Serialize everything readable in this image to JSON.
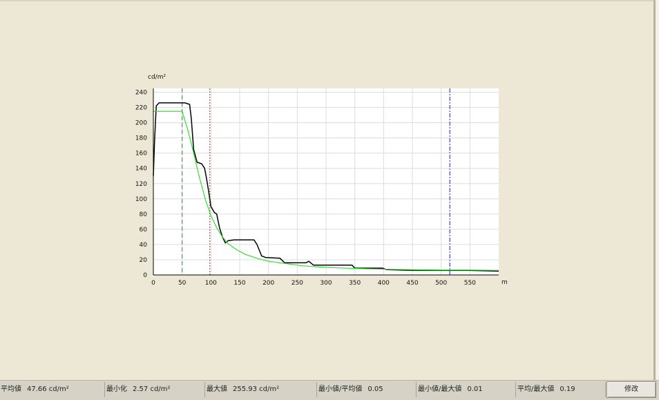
{
  "chart_data": {
    "type": "line",
    "ylabel": "cd/m²",
    "xlabel": "m",
    "xlim": [
      0,
      600
    ],
    "ylim": [
      0,
      245
    ],
    "x_ticks": [
      0,
      50,
      100,
      150,
      200,
      250,
      300,
      350,
      400,
      450,
      500,
      550
    ],
    "y_ticks": [
      0,
      20,
      40,
      60,
      80,
      100,
      120,
      140,
      160,
      180,
      200,
      220,
      240
    ],
    "grid": true,
    "series": [
      {
        "color": "#000000",
        "points": [
          [
            0,
            130
          ],
          [
            2,
            175
          ],
          [
            5,
            222
          ],
          [
            10,
            226
          ],
          [
            20,
            226
          ],
          [
            40,
            226
          ],
          [
            55,
            226
          ],
          [
            63,
            224
          ],
          [
            66,
            205
          ],
          [
            70,
            165
          ],
          [
            76,
            148
          ],
          [
            84,
            146
          ],
          [
            89,
            140
          ],
          [
            92,
            128
          ],
          [
            96,
            110
          ],
          [
            100,
            90
          ],
          [
            106,
            82
          ],
          [
            110,
            80
          ],
          [
            115,
            62
          ],
          [
            120,
            50
          ],
          [
            125,
            42
          ],
          [
            130,
            45
          ],
          [
            140,
            46
          ],
          [
            150,
            46
          ],
          [
            175,
            46
          ],
          [
            180,
            40
          ],
          [
            188,
            25
          ],
          [
            195,
            23
          ],
          [
            220,
            22
          ],
          [
            228,
            16
          ],
          [
            265,
            16
          ],
          [
            270,
            18
          ],
          [
            278,
            13
          ],
          [
            300,
            13
          ],
          [
            345,
            13
          ],
          [
            350,
            9
          ],
          [
            398,
            9
          ],
          [
            405,
            7
          ],
          [
            450,
            6
          ],
          [
            500,
            6
          ],
          [
            550,
            6
          ],
          [
            600,
            5
          ]
        ]
      },
      {
        "color": "#33dd33",
        "points": [
          [
            0,
            215
          ],
          [
            20,
            215
          ],
          [
            40,
            215
          ],
          [
            50,
            215
          ],
          [
            60,
            190
          ],
          [
            70,
            160
          ],
          [
            80,
            128
          ],
          [
            90,
            100
          ],
          [
            100,
            78
          ],
          [
            110,
            62
          ],
          [
            120,
            50
          ],
          [
            130,
            41
          ],
          [
            145,
            33
          ],
          [
            160,
            27
          ],
          [
            180,
            22
          ],
          [
            200,
            18
          ],
          [
            230,
            15
          ],
          [
            260,
            12
          ],
          [
            300,
            10
          ],
          [
            350,
            8.5
          ],
          [
            400,
            7.5
          ],
          [
            450,
            7
          ],
          [
            500,
            6.5
          ],
          [
            550,
            6.5
          ],
          [
            600,
            6
          ]
        ]
      }
    ],
    "markers": [
      {
        "x": 50,
        "color": "#2ea84a",
        "style": "dashed"
      },
      {
        "x": 98,
        "color": "#e24040",
        "style": "dotted"
      },
      {
        "x": 515,
        "color": "#3b3bd6",
        "style": "dashdot"
      }
    ]
  },
  "status": {
    "avg_label": "平均値",
    "avg_value": "47.66  cd/m²",
    "min_label": "最小化",
    "min_value": "2.57  cd/m²",
    "max_label": "最大値",
    "max_value": "255.93  cd/m²",
    "min_avg_label": "最小値/平均値",
    "min_avg_value": "0.05",
    "min_max_label": "最小値/最大値",
    "min_max_value": "0.01",
    "avg_max_label": "平均/最大値",
    "avg_max_value": "0.19"
  },
  "edit_label": "修改"
}
